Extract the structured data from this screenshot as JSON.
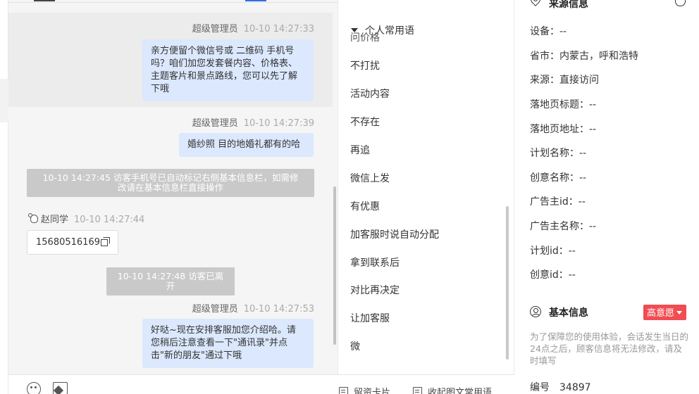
{
  "messages": [
    {
      "sender": "超级管理员",
      "time": "10-10 14:27:33",
      "lines": [
        "亲方便留个微信号或 二维码 手机号",
        "吗？咱们加您发套餐内容、价格表、",
        "主题客片和景点路线，您可以先了解",
        "下哦"
      ]
    },
    {
      "sender": "超级管理员",
      "time": "10-10 14:27:39",
      "lines": [
        "婚纱照 目的地婚礼都有的哈"
      ]
    },
    {
      "notice_lines": [
        "10-10 14:27:45 访客手机号已自动标记右侧基本信息栏，如需修",
        "改请在基本信息栏直接操作"
      ]
    },
    {
      "sender": "赵同学",
      "time": "10-10 14:27:44",
      "text": "15680516169"
    },
    {
      "notice": "10-10 14:27:48 访客已离开"
    },
    {
      "sender": "超级管理员",
      "time": "10-10 14:27:53",
      "lines": [
        "好哒~现在安排客服加您介绍哈。请",
        "您稍后注意查看一下\"通讯录\"并点",
        "击\"新的朋友\"通过下哦"
      ]
    }
  ],
  "toolbar": {
    "emoji": "smile-icon",
    "image": "image-icon",
    "card_label": "留资卡片",
    "collect_label": "收起图文常用语"
  },
  "phrases": {
    "header": "个人常用语",
    "partial_item": "问价格",
    "items": [
      "不打扰",
      "活动内容",
      "不存在",
      "再追",
      "微信上发",
      "有优惠",
      "加客服时说自动分配",
      "拿到联系后",
      "对比再决定",
      "让加客服",
      "微"
    ]
  },
  "info": {
    "source_title": "来源信息",
    "source_fields": [
      "设备：--",
      "省市：内蒙古，呼和浩特",
      "来源：直接访问",
      "落地页标题：--",
      "落地页地址：--",
      "计划名称：--",
      "创意名称：--",
      "广告主id：--",
      "广告主名称：--",
      "计划id：--",
      "创意id：--"
    ],
    "basic_title": "基本信息",
    "intent_badge": "高意愿",
    "note": "为了保障您的使用体验，会话发生当日的24点之后，顾客信息将无法修改，请及时填写",
    "serial_label": "编号",
    "serial_value": "34897"
  }
}
